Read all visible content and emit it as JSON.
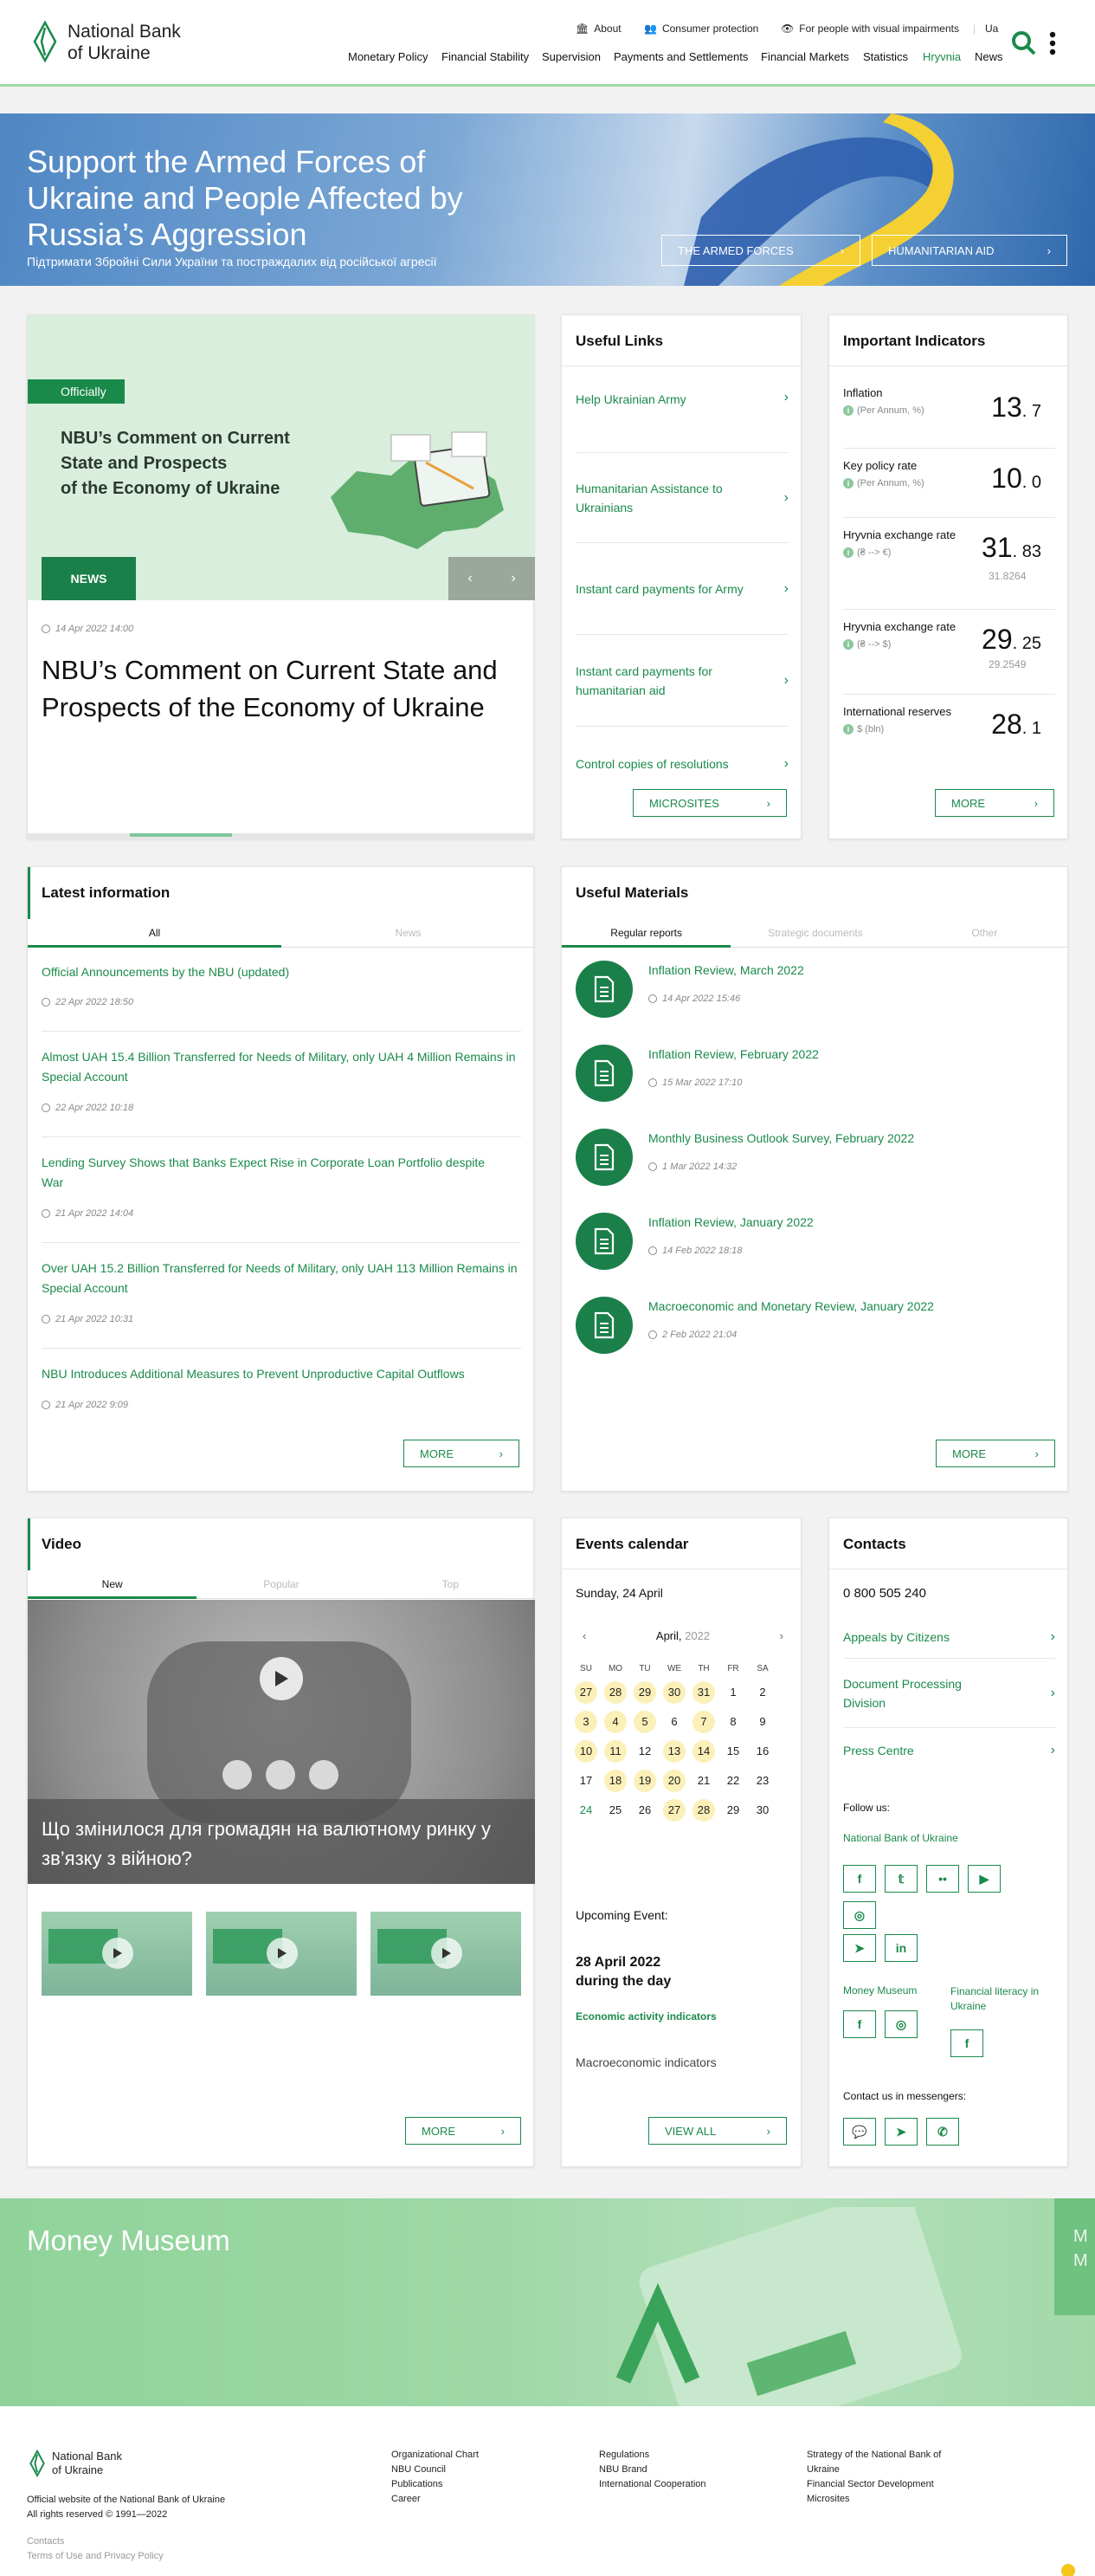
{
  "header": {
    "logo_line1": "National Bank",
    "logo_line2": "of Ukraine",
    "top_links": [
      "About",
      "Consumer protection",
      "For people with visual impairments"
    ],
    "lang": "Ua",
    "nav": [
      "Monetary Policy",
      "Financial Stability",
      "Supervision",
      "Payments and Settlements",
      "Financial Markets",
      "Statistics",
      "Hryvnia",
      "News"
    ],
    "active_nav": "Hryvnia"
  },
  "hero": {
    "title_l1": "Support the Armed Forces of",
    "title_l2": "Ukraine and People Affected by",
    "title_l3": "Russia’s Aggression",
    "subtitle": "Підтримати Збройні Сили України та постраждалих від російської агресії",
    "btn1": "THE ARMED FORCES",
    "btn2": "HUMANITARIAN AID"
  },
  "news_slider": {
    "badge": "Officially",
    "img_title_l1": "NBU’s Comment on Current",
    "img_title_l2": "State and Prospects",
    "img_title_l3": "of the Economy of Ukraine",
    "tag": "NEWS",
    "date": "14 Apr 2022 14:00",
    "title": "NBU’s Comment on Current State and Prospects of the Economy of Ukraine"
  },
  "useful_links": {
    "title": "Useful Links",
    "items": [
      "Help Ukrainian Army",
      "Humanitarian Assistance to Ukrainians",
      "Instant card payments for Army",
      "Instant card payments for humanitarian aid",
      "Control copies of resolutions"
    ],
    "button": "MICROSITES"
  },
  "indicators": {
    "title": "Important Indicators",
    "items": [
      {
        "label": "Inflation",
        "sub": "(Per Annum, %)",
        "int": "13",
        "dec": "7",
        "prev": ""
      },
      {
        "label": "Key policy rate",
        "sub": "(Per Annum, %)",
        "int": "10",
        "dec": "0",
        "prev": ""
      },
      {
        "label": "Hryvnia exchange rate",
        "sub": "(₴ --> €)",
        "int": "31",
        "dec": "83",
        "prev": "31.8264"
      },
      {
        "label": "Hryvnia exchange rate",
        "sub": "(₴ --> $)",
        "int": "29",
        "dec": "25",
        "prev": "29.2549"
      },
      {
        "label": "International reserves",
        "sub": "$ (bln)",
        "int": "28",
        "dec": "1",
        "prev": ""
      }
    ],
    "button": "MORE"
  },
  "latest": {
    "title": "Latest information",
    "tabs": [
      "All",
      "News"
    ],
    "items": [
      {
        "t": "Official Announcements by the NBU (updated)",
        "d": "22 Apr 2022 18:50"
      },
      {
        "t": "Almost UAH 15.4 Billion Transferred for Needs of Military, only UAH 4 Million Remains in Special Account",
        "d": "22 Apr 2022 10:18"
      },
      {
        "t": "Lending Survey Shows that Banks Expect Rise in Corporate Loan Portfolio despite War",
        "d": "21 Apr 2022 14:04"
      },
      {
        "t": "Over UAH 15.2 Billion Transferred for Needs of Military, only UAH 113 Million Remains in Special Account",
        "d": "21 Apr 2022 10:31"
      },
      {
        "t": "NBU Introduces Additional Measures to Prevent Unproductive Capital Outflows",
        "d": "21 Apr 2022 9:09"
      }
    ],
    "button": "MORE"
  },
  "materials": {
    "title": "Useful Materials",
    "tabs": [
      "Regular reports",
      "Strategic documents",
      "Other"
    ],
    "items": [
      {
        "t": "Inflation Review, March 2022",
        "d": "14 Apr 2022 15:46"
      },
      {
        "t": "Inflation Review, February 2022",
        "d": "15 Mar 2022 17:10"
      },
      {
        "t": "Monthly Business Outlook Survey, February 2022",
        "d": "1 Mar 2022 14:32"
      },
      {
        "t": "Inflation Review, January 2022",
        "d": "14 Feb 2022 18:18"
      },
      {
        "t": "Macroeconomic and Monetary Review, January 2022",
        "d": "2 Feb 2022 21:04"
      }
    ],
    "button": "MORE"
  },
  "video": {
    "title": "Video",
    "tabs": [
      "New",
      "Popular",
      "Top"
    ],
    "caption": "Що змінилося для громадян на валютному ринку у зв’язку з війною?",
    "button": "MORE"
  },
  "calendar": {
    "title": "Events calendar",
    "today": "Sunday, 24 April",
    "month": "April,",
    "year": "2022",
    "days": [
      "SU",
      "MO",
      "TU",
      "WE",
      "TH",
      "FR",
      "SA"
    ],
    "weeks": [
      [
        "27",
        "28",
        "29",
        "30",
        "31",
        "1",
        "2"
      ],
      [
        "3",
        "4",
        "5",
        "6",
        "7",
        "8",
        "9"
      ],
      [
        "10",
        "11",
        "12",
        "13",
        "14",
        "15",
        "16"
      ],
      [
        "17",
        "18",
        "19",
        "20",
        "21",
        "22",
        "23"
      ],
      [
        "24",
        "25",
        "26",
        "27",
        "28",
        "29",
        "30"
      ]
    ],
    "upcoming_label": "Upcoming Event:",
    "upcoming_date_l1": "28 April 2022",
    "upcoming_date_l2": "during the day",
    "upcoming_link": "Economic activity indicators",
    "upcoming_text": "Macroeconomic indicators",
    "button": "VIEW ALL"
  },
  "contacts": {
    "title": "Contacts",
    "phone": "0 800 505 240",
    "links": [
      "Appeals by Citizens",
      "Document Processing Division",
      "Press Centre"
    ],
    "follow": "Follow us:",
    "nbu": "National Bank of Ukraine",
    "money_museum": "Money Museum",
    "fin_lit": "Financial literacy in Ukraine",
    "messengers": "Contact us in messengers:"
  },
  "museum_banner": {
    "title": "Money Museum",
    "edge_text": "M M"
  },
  "footer": {
    "logo_line1": "National Bank",
    "logo_line2": "of Ukraine",
    "official": "Official website of the National Bank of Ukraine",
    "rights": "All rights reserved © 1991—2022",
    "contacts": "Contacts",
    "terms": "Terms of Use and Privacy Policy",
    "col1": [
      "Organizational Chart",
      "NBU Council",
      "Publications",
      "Career"
    ],
    "col2": [
      "Regulations",
      "NBU Brand",
      "International Cooperation"
    ],
    "col3": [
      "Strategy of the National Bank of Ukraine",
      "Financial Sector Development",
      "Microsites"
    ]
  }
}
